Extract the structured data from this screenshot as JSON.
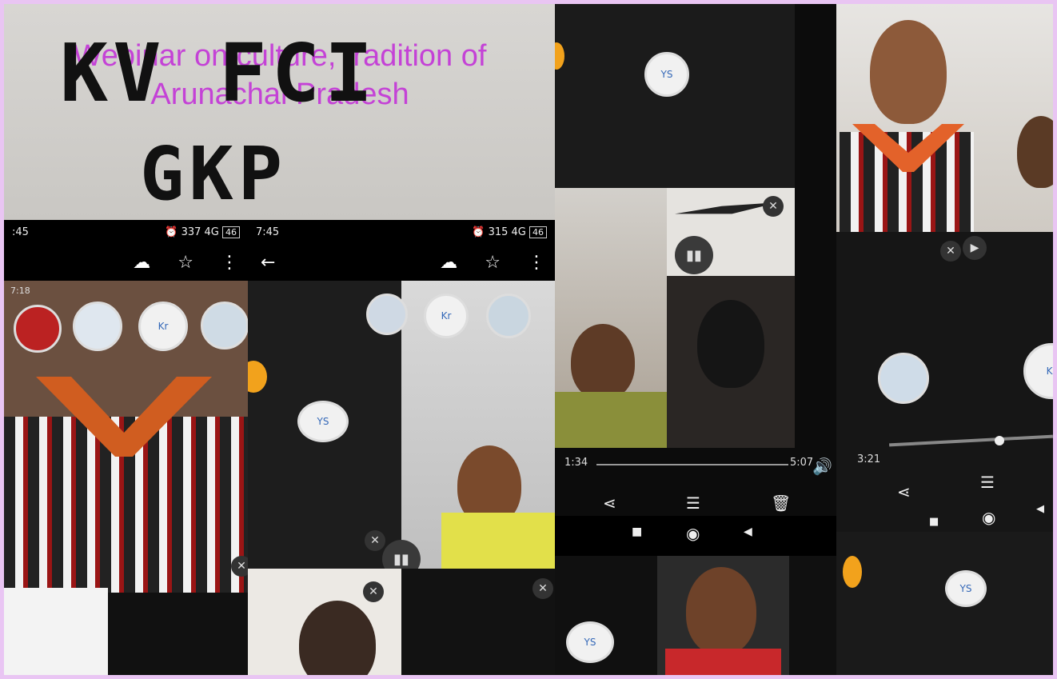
{
  "overlay": {
    "webinar_line1": "Webinar on culture, tradition of",
    "webinar_line2": "Arunachal Pradesh",
    "title_line1": "KV FCI",
    "title_line2": "GKP"
  },
  "screen1": {
    "status_time": ":45",
    "status_speed": "337",
    "status_battery": "46",
    "inner_status": "7:18"
  },
  "screen2": {
    "status_time": "7:45",
    "status_speed": "315",
    "status_battery": "46"
  },
  "participants": {
    "ys": "YS",
    "kr": "Kr"
  },
  "player": {
    "left_time": "1:34",
    "right_time": "5:07",
    "current_time": "3:21"
  },
  "colors": {
    "title_text": "#111111",
    "webinar_text": "#c22ad8",
    "frame": "#e9c5f3"
  }
}
